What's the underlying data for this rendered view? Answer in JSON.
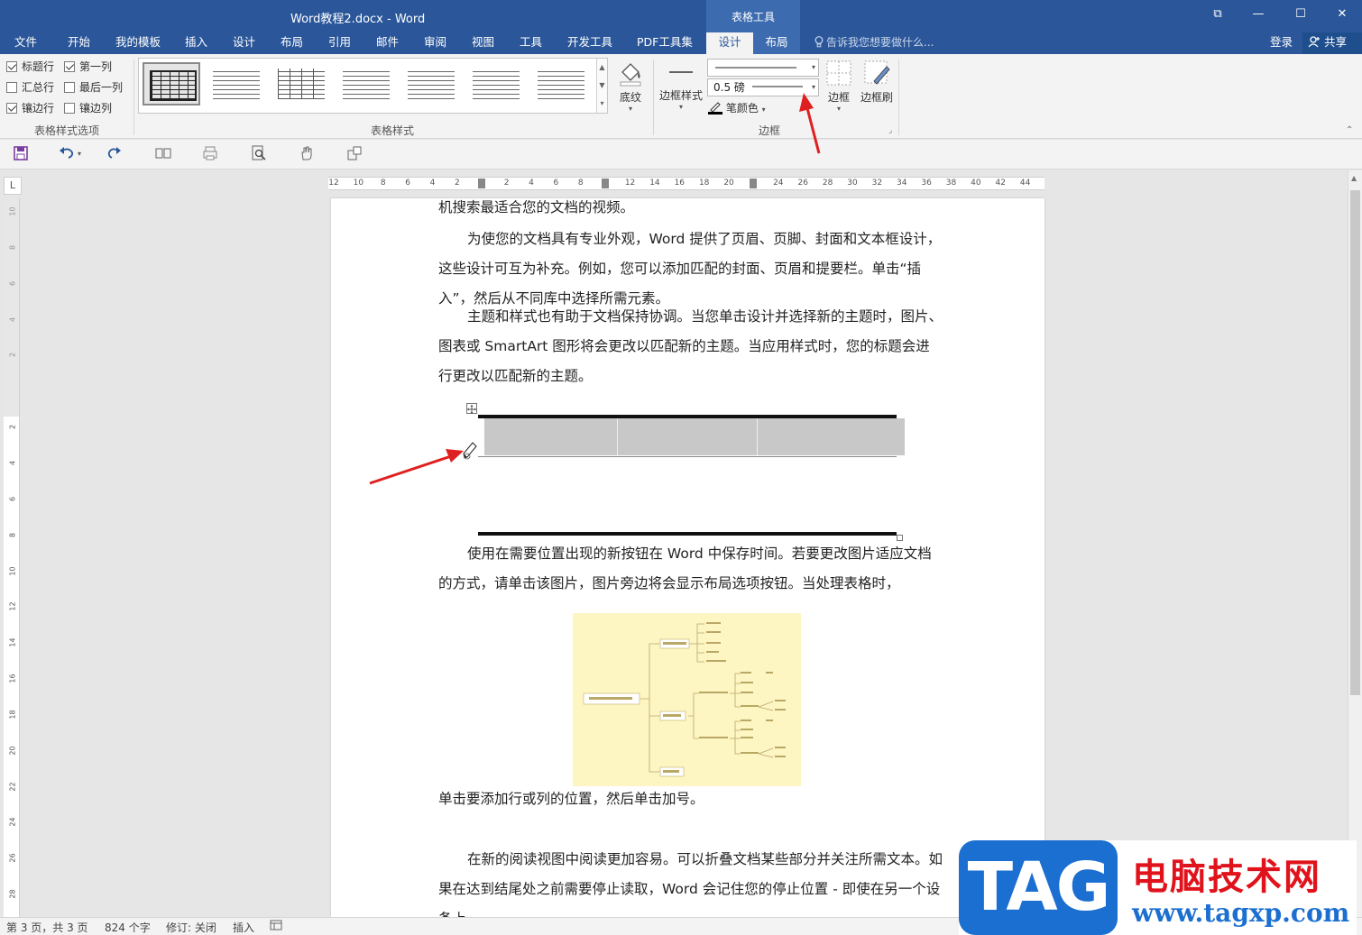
{
  "window": {
    "title": "Word教程2.docx - Word",
    "context_tab_group": "表格工具",
    "controls": [
      "⧉",
      "—",
      "☐",
      "✕"
    ]
  },
  "menu": {
    "tabs": [
      "文件",
      "开始",
      "我的模板",
      "插入",
      "设计",
      "布局",
      "引用",
      "邮件",
      "审阅",
      "视图",
      "工具",
      "开发工具",
      "PDF工具集",
      "设计",
      "布局"
    ],
    "active_index": 13,
    "tell_me": "告诉我您想要做什么...",
    "sign_in": "登录",
    "share": "共享"
  },
  "ribbon": {
    "style_options": {
      "label": "表格样式选项",
      "checks": [
        {
          "label": "标题行",
          "checked": true
        },
        {
          "label": "第一列",
          "checked": true
        },
        {
          "label": "汇总行",
          "checked": false
        },
        {
          "label": "最后一列",
          "checked": false
        },
        {
          "label": "镶边行",
          "checked": true
        },
        {
          "label": "镶边列",
          "checked": false
        }
      ]
    },
    "table_styles": {
      "label": "表格样式",
      "shading": "底纹"
    },
    "borders": {
      "label": "边框",
      "border_styles": "边框样式",
      "line_style_value": "",
      "line_weight": "0.5 磅",
      "pen_color": "笔颜色",
      "borders_btn": "边框",
      "border_painter": "边框刷"
    }
  },
  "ruler": {
    "horizontal_ticks": [
      "12",
      "10",
      "8",
      "6",
      "4",
      "2",
      "",
      "2",
      "4",
      "6",
      "8",
      "",
      "12",
      "14",
      "16",
      "18",
      "20",
      "",
      "24",
      "26",
      "28",
      "30",
      "32",
      "34",
      "36",
      "38",
      "40",
      "42",
      "44"
    ],
    "vertical_ticks": [
      "10",
      "8",
      "6",
      "4",
      "2",
      "",
      "2",
      "4",
      "6",
      "8",
      "10",
      "12",
      "14",
      "16",
      "18",
      "20",
      "22",
      "24",
      "26",
      "28"
    ],
    "corner": "L"
  },
  "document": {
    "para1": "机搜索最适合您的文档的视频。",
    "para2": "为使您的文档具有专业外观，Word 提供了页眉、页脚、封面和文本框设计，这些设计可互为补充。例如，您可以添加匹配的封面、页眉和提要栏。单击“插入”，然后从不同库中选择所需元素。",
    "para3": "主题和样式也有助于文档保持协调。当您单击设计并选择新的主题时，图片、图表或 SmartArt 图形将会更改以匹配新的主题。当应用样式时，您的标题会进行更改以匹配新的主题。",
    "para4": "使用在需要位置出现的新按钮在 Word 中保存时间。若要更改图片适应文档的方式，请单击该图片，图片旁边将会显示布局选项按钮。当处理表格时，",
    "para5": "单击要添加行或列的位置，然后单击加号。",
    "para6": "在新的阅读视图中阅读更加容易。可以折叠文档某些部分并关注所需文本。如果在达到结尾处之前需要停止读取，Word 会记住您的停止位置 - 即使在另一个设备上。",
    "table_columns": 3
  },
  "status": {
    "page": "第 3 页，共 3 页",
    "words": "824 个字",
    "track": "修订: 关闭",
    "mode": "插入"
  },
  "watermark": {
    "tag": "TAG",
    "cn": "电脑技术网",
    "url": "www.tagxp.com"
  },
  "colors": {
    "title_bar": "#2b579a",
    "context_tab": "#3c6bb0",
    "arrow": "#e02020"
  }
}
